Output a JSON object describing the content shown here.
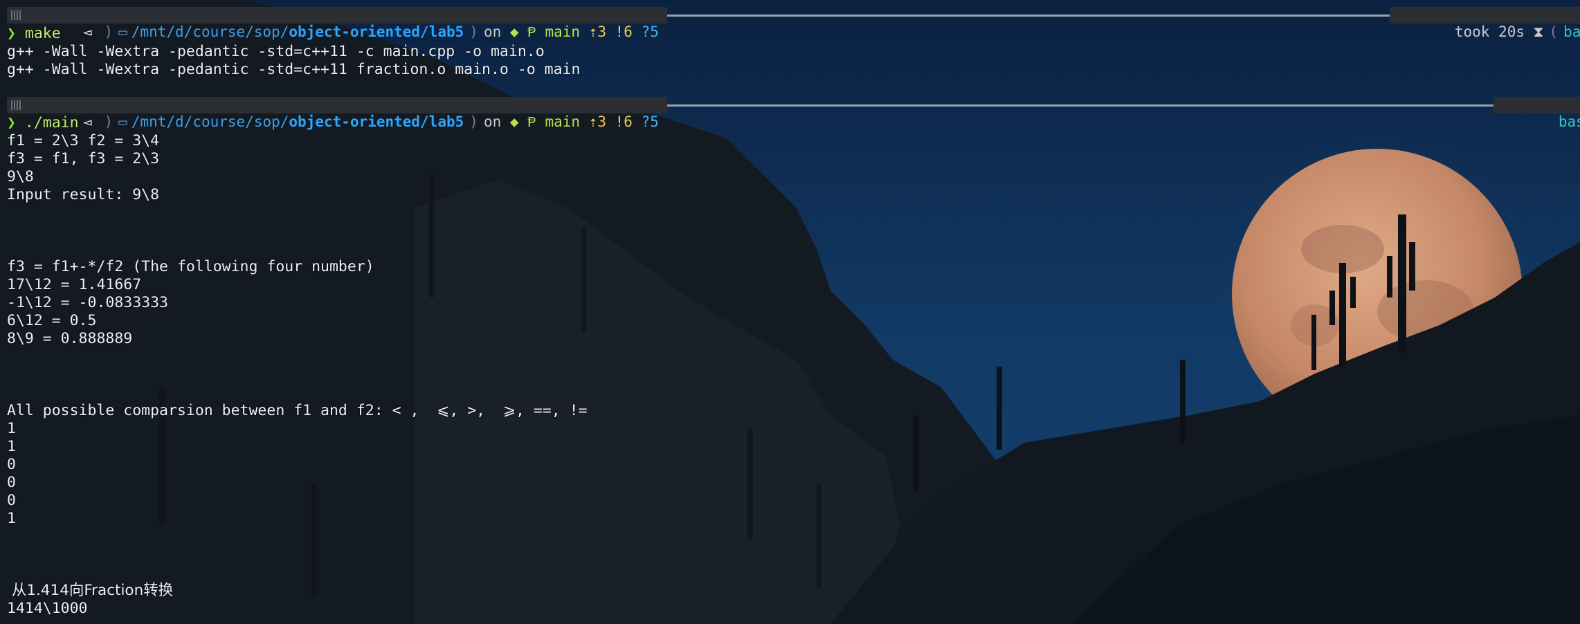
{
  "prompt1": {
    "path_dim": "/mnt/d/course/sop/",
    "path_bold": "object-oriented/lab5",
    "on_label": "on",
    "branch": "main",
    "ahead": "⇡3",
    "modified": "!6",
    "untracked": "?5",
    "took_label": "took 20s",
    "hourglass_icon": "⧗",
    "env": "base"
  },
  "command1": {
    "chevron": "❯",
    "text": "make"
  },
  "output1": [
    "g++ -Wall -Wextra -pedantic -std=c++11 -c main.cpp -o main.o",
    "g++ -Wall -Wextra -pedantic -std=c++11 fraction.o main.o -o main"
  ],
  "prompt2": {
    "path_dim": "/mnt/d/course/sop/",
    "path_bold": "object-oriented/lab5",
    "on_label": "on",
    "branch": "main",
    "ahead": "⇡3",
    "modified": "!6",
    "untracked": "?5",
    "env": "base"
  },
  "command2": {
    "chevron": "❯",
    "text": "./main"
  },
  "output2": {
    "block_a": [
      "f1 = 2\\3 f2 = 3\\4",
      "f3 = f1, f3 = 2\\3",
      "9\\8",
      "Input result: 9\\8"
    ],
    "block_b": [
      "f3 = f1+-*/f2 (The following four number)",
      "17\\12 = 1.41667",
      "-1\\12 = -0.0833333",
      "6\\12 = 0.5",
      "8\\9 = 0.888889"
    ],
    "block_c": [
      "All possible comparsion between f1 and f2: < ,  ⩽, >,  ⩾, ==, !=",
      "1",
      "1",
      "0",
      "0",
      "0",
      "1"
    ],
    "block_d": [
      " 从1.414向Fraction转换",
      "1414\\1000"
    ]
  },
  "colors": {
    "terminal_text": "#ecf0f3",
    "prompt_segment_bg": "#2b2f33",
    "path_blue": "#2aa7ff",
    "git_green": "#b7e24a",
    "git_yellow": "#f2c94c",
    "env_cyan": "#37c6c6",
    "chevron_green": "#8ee036",
    "sky": "#0f2a4a",
    "moon": "#c98e6c"
  },
  "icons": {
    "os": "linux-os-icon",
    "folder": "folder-icon",
    "git_branch": "git-branch-icon",
    "python_env": "python-env-icon",
    "hourglass": "hourglass-icon"
  }
}
